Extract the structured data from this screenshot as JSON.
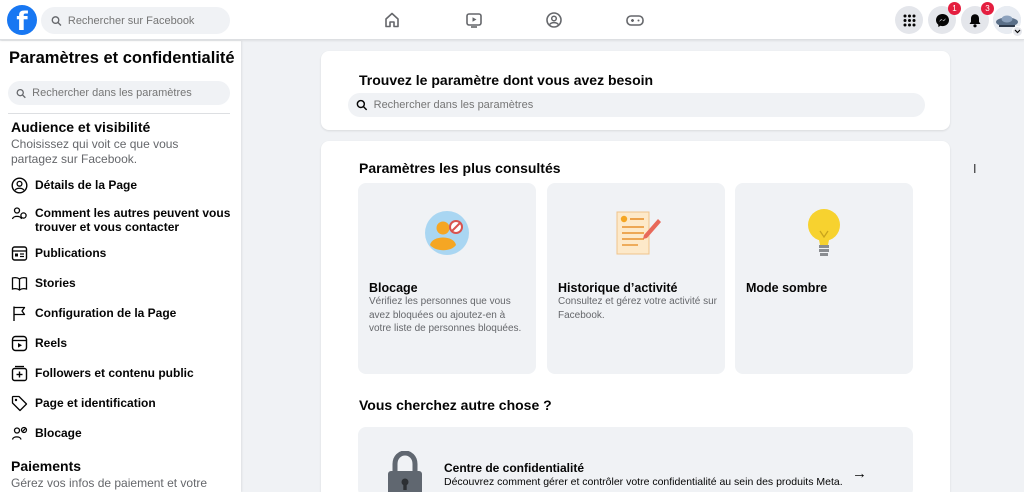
{
  "topbar": {
    "logo_letter": "f",
    "search_placeholder": "Rechercher sur Facebook",
    "nav_icons": [
      "home-icon",
      "video-icon",
      "groups-icon",
      "gaming-icon"
    ],
    "messenger_badge": "1",
    "notifications_badge": "3"
  },
  "sidebar": {
    "title": "Paramètres et confidentialité",
    "search_placeholder": "Rechercher dans les paramètres",
    "audience": {
      "title": "Audience et visibilité",
      "description": "Choisissez qui voit ce que vous partagez sur Facebook."
    },
    "items": [
      {
        "label": "Détails de la Page",
        "icon": "user-circle-icon"
      },
      {
        "label": "Comment les autres peuvent vous trouver et vous contacter",
        "icon": "people-icon"
      },
      {
        "label": "Publications",
        "icon": "posts-icon"
      },
      {
        "label": "Stories",
        "icon": "book-icon"
      },
      {
        "label": "Configuration de la Page",
        "icon": "flag-icon"
      },
      {
        "label": "Reels",
        "icon": "reels-icon"
      },
      {
        "label": "Followers et contenu public",
        "icon": "followers-icon"
      },
      {
        "label": "Page et identification",
        "icon": "tag-icon"
      },
      {
        "label": "Blocage",
        "icon": "block-user-icon"
      }
    ],
    "payments": {
      "title": "Paiements",
      "description": "Gérez vos infos de paiement et votre"
    }
  },
  "main": {
    "find_title": "Trouvez le paramètre dont vous avez besoin",
    "find_placeholder": "Rechercher dans les paramètres",
    "most_viewed_title": "Paramètres les plus consultés",
    "tiles": [
      {
        "title": "Blocage",
        "description": "Vérifiez les personnes que vous avez bloquées ou ajoutez-en à votre liste de personnes bloquées.",
        "icon": "blocked-person-icon"
      },
      {
        "title": "Historique d’activité",
        "description": "Consultez et gérez votre activité sur Facebook.",
        "icon": "activity-log-icon"
      },
      {
        "title": "Mode sombre",
        "description": "",
        "icon": "lightbulb-icon"
      }
    ],
    "other_title": "Vous cherchez autre chose ?",
    "privacy_center": {
      "title": "Centre de confidentialité",
      "description": "Découvrez comment gérer et contrôler votre confidentialité au sein des produits Meta.",
      "arrow": "→"
    }
  },
  "colors": {
    "brand": "#1877f2",
    "badge": "#e41e3f",
    "page_bg": "#f0f2f5"
  }
}
